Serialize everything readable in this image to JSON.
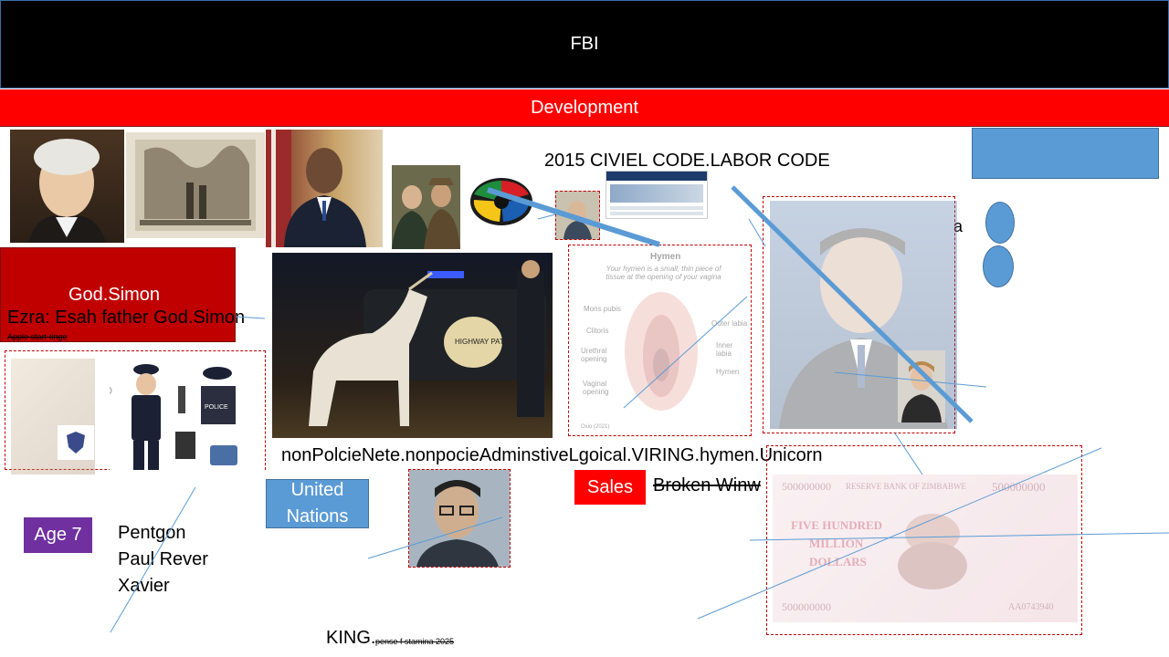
{
  "header": {
    "title": "FBI",
    "subtitle": "Development"
  },
  "labels": {
    "code_title": "2015 CIVIEL CODE.LABOR CODE",
    "god_simon": "God.Simon",
    "ezra": "Ezra: Esah father God.Simon",
    "apple_small": "Apple start-tinge",
    "long_line": "nonPolcieNete.nonpocieAdminstiveLgoical.VIRING.hymen.Unicorn",
    "united_nations_1": "United",
    "united_nations_2": "Nations",
    "sales": "Sales",
    "broken": "Broken Winw",
    "age": "Age 7",
    "names": [
      "Pentgon",
      "Paul Rever",
      "Xavier"
    ],
    "king": "KING.",
    "king_small": "pense f stamina 2025",
    "side_letter": "a"
  },
  "hymen_diagram": {
    "title": "Hymen",
    "caption": "Your hymen is a small, thin piece of tissue at the opening of your vagina",
    "left_labels": [
      "Mons pubis",
      "Clitoris",
      "Urethral opening",
      "Vaginal opening"
    ],
    "right_labels": [
      "Outer labia",
      "Inner labia",
      "Hymen"
    ],
    "footer": "Oxio (2021)"
  },
  "banknote": {
    "bank": "RESERVE BANK OF ZIMBABWE",
    "amount": "500000000",
    "words_1": "FIVE HUNDRED",
    "words_2": "MILLION",
    "words_3": "DOLLARS",
    "serial": "AA0743940"
  },
  "police_card": {
    "badge": "POLICE"
  },
  "car_text": "HIGHWAY PATROL",
  "colors": {
    "header_bg": "#000000",
    "dev_bg": "#ff0000",
    "god_box": "#c00000",
    "un_box": "#5b9bd5",
    "sales_box": "#ff0000",
    "age_box": "#7030a0",
    "blue_shape": "#5b9bd5"
  }
}
